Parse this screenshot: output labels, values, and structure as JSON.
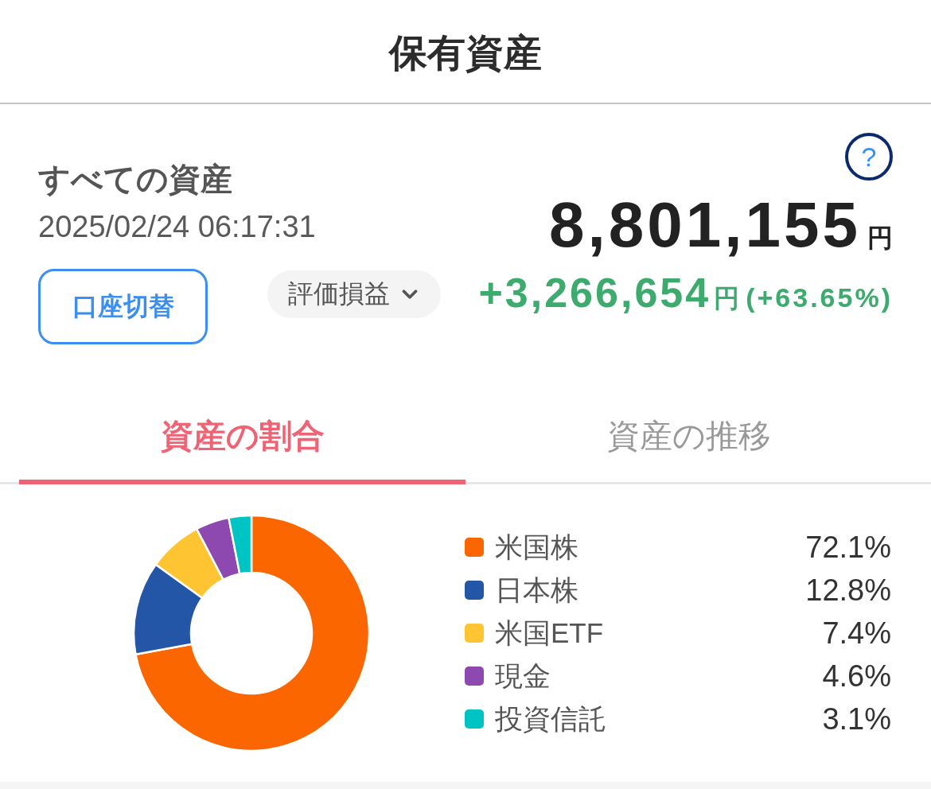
{
  "header": {
    "title": "保有資産"
  },
  "summary": {
    "title": "すべての資産",
    "timestamp": "2025/02/24 06:17:31",
    "help_button": "?",
    "total": {
      "amount": "8,801,155",
      "unit": "円"
    },
    "account_button": "口座切替",
    "metric_dropdown": {
      "label": "評価損益"
    },
    "gain": {
      "amount": "+3,266,654",
      "unit": "円",
      "percent": "(+63.65%)"
    }
  },
  "tabs": [
    {
      "label": "資産の割合",
      "selected": true
    },
    {
      "label": "資産の推移",
      "selected": false
    }
  ],
  "allocation": {
    "legend": [
      {
        "value": "72.1%",
        "color": "#fc6600"
      },
      {
        "value": "12.8%",
        "color": "#2456a8"
      },
      {
        "value": "7.4%",
        "color": "#fec432"
      },
      {
        "value": "4.6%",
        "color": "#8e49b0"
      },
      {
        "value": "3.1%",
        "color": "#00c4c4"
      }
    ],
    "chart_data": {
      "type": "donut",
      "categories": [
        "米国株",
        "日本株",
        "米国ETF",
        "現金",
        "投資信託"
      ],
      "values": [
        72.1,
        12.8,
        7.4,
        4.6,
        3.1
      ]
    }
  }
}
